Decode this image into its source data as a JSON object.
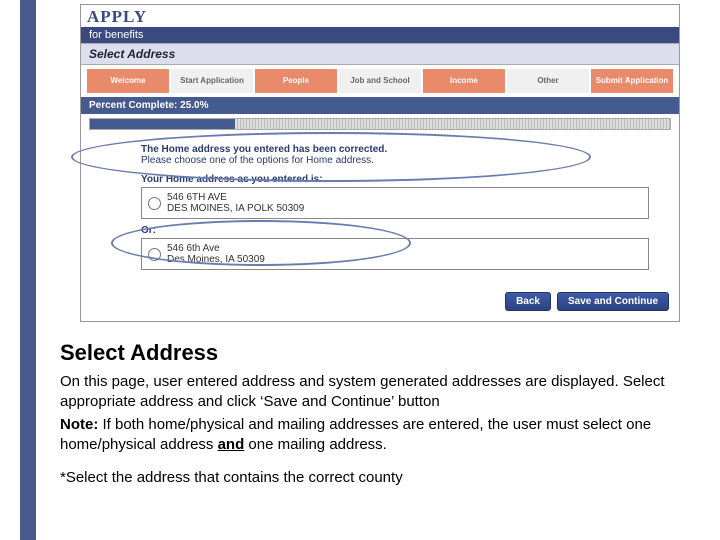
{
  "brand": {
    "title": "APPLY",
    "subtitle": "for benefits"
  },
  "page_title": "Select Address",
  "steps": [
    "Welcome",
    "Start Application",
    "People",
    "Job and School",
    "Income",
    "Other",
    "Submit Application"
  ],
  "progress": {
    "label": "Percent Complete: 25.0%",
    "value": 25.0
  },
  "corrected": {
    "heading": "The Home address you entered has been corrected.",
    "sub": "Please choose one of the options for Home address."
  },
  "entered": {
    "caption": "Your Home address as you entered is:",
    "line1": "546 6TH AVE",
    "line2": "DES MOINES, IA POLK 50309"
  },
  "or_label": "Or:",
  "suggested": {
    "line1": "546 6th Ave",
    "line2": "Des Moines, IA 50309"
  },
  "buttons": {
    "back": "Back",
    "save": "Save and Continue"
  },
  "instructions": {
    "heading": "Select Address",
    "p1": "On this page, user entered address and system generated addresses are displayed. Select appropriate address and click ‘Save and Continue’ button",
    "note_label": "Note:",
    "note_body_a": " If both home/physical and mailing addresses are entered, the user must select one home/physical address ",
    "note_and": "and",
    "note_body_b": " one mailing address.",
    "footnote": "*Select the address that contains the correct county"
  }
}
